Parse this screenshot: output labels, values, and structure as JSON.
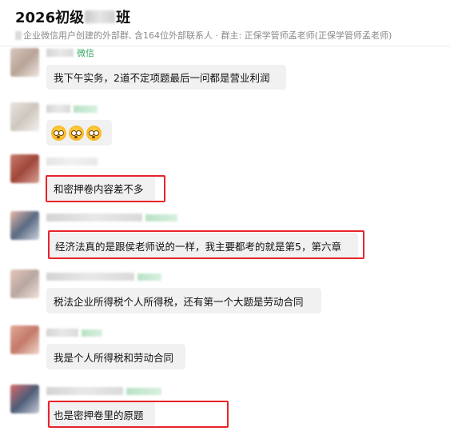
{
  "header": {
    "title_prefix": "2026初级",
    "title_suffix": "班",
    "subtitle": "企业微信用户创建的外部群, 含164位外部联系人 · 群主: 正保学管师孟老师(正保学管师孟老师)"
  },
  "messages": [
    {
      "tag": "微信",
      "text": "我下午实务，2道不定项题最后一问都是营业利润",
      "highlighted": false
    },
    {
      "tag": "",
      "emoji_count": 3,
      "emoji_icon": "flushed-face-icon",
      "highlighted": false
    },
    {
      "tag": "",
      "text": "和密押卷内容差不多",
      "highlighted": true
    },
    {
      "tag": "",
      "text": "经济法真的是跟侯老师说的一样，我主要都考的就是第5，第六章",
      "highlighted": true
    },
    {
      "tag": "",
      "text": "税法企业所得税个人所得税，还有第一个大题是劳动合同",
      "highlighted": false
    },
    {
      "tag": "",
      "text": "我是个人所得税和劳动合同",
      "highlighted": false
    },
    {
      "tag": "",
      "text": "也是密押卷里的原题",
      "highlighted": true
    }
  ],
  "colors": {
    "highlight_border": "#e8232a",
    "bubble_bg": "#f1f1f1",
    "tag_green": "#3aa866"
  }
}
